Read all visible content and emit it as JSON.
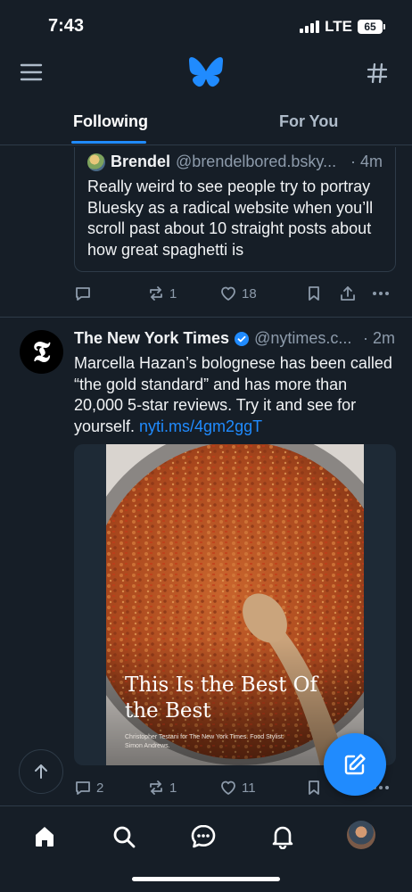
{
  "status_bar": {
    "time": "7:43",
    "network": "LTE",
    "battery": "65"
  },
  "header": {
    "menu_icon": "hamburger-menu-icon",
    "logo_icon": "bluesky-butterfly-icon",
    "feeds_icon": "hashtag-icon"
  },
  "tabs": [
    {
      "label": "Following",
      "active": true
    },
    {
      "label": "For You",
      "active": false
    }
  ],
  "quoted_post": {
    "author_name": "Brendel",
    "author_handle": "@brendelbored.bsky...",
    "time": "· 4m",
    "text": "Really weird to see people try to portray Bluesky as a radical website when you’ll scroll past about 10 straight posts about how great spaghetti is"
  },
  "post1_actions": {
    "replies": "",
    "reposts": "1",
    "likes": "18"
  },
  "post2": {
    "author_name": "The New York Times",
    "author_handle": "@nytimes.c...",
    "time": "· 2m",
    "text": "Marcella Hazan’s bolognese has been called “the gold standard” and has more than 20,000 5-star reviews. Try it and see for yourself. ",
    "link": "nyti.ms/4gm2ggT",
    "image_headline": "This Is the Best Of the Best",
    "image_credit": "Christopher Testani for The New York Times. Food Stylist: Simon Andrews.",
    "replies": "2",
    "reposts": "1",
    "likes": "11"
  },
  "bottom_nav": [
    "home-icon",
    "search-icon",
    "chat-icon",
    "notifications-bell-icon",
    "profile-avatar"
  ],
  "colors": {
    "background": "#161e27",
    "accent": "#208bfe",
    "muted": "#8d9bab",
    "divider": "#2e3b48"
  }
}
